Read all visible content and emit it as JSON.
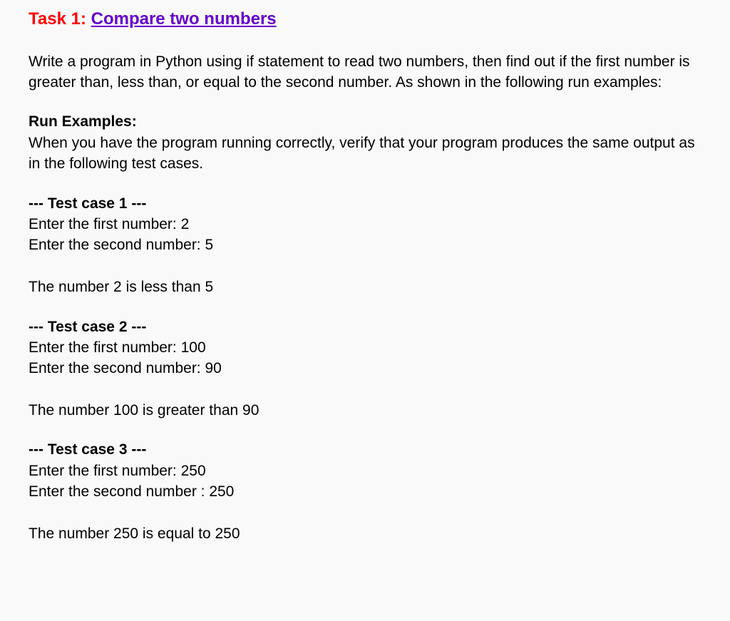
{
  "heading": {
    "label": "Task 1: ",
    "link": "Compare two numbers"
  },
  "description": "Write a program in Python using if statement to read two numbers, then find out if the first number is greater than, less than, or equal to the second number. As shown in the following run examples:",
  "run_examples": {
    "heading": "Run Examples:",
    "intro": "When you have the program running correctly, verify that your program produces the same output as in the following test cases."
  },
  "test_cases": [
    {
      "title": "--- Test case 1 ---",
      "line1": "Enter the first number: 2",
      "line2": "Enter the second number: 5",
      "result": "The number 2 is less than 5"
    },
    {
      "title": "--- Test case 2 ---",
      "line1": "Enter the first number: 100",
      "line2": "Enter the second number: 90",
      "result": "The number 100 is greater than 90"
    },
    {
      "title": "--- Test case 3 ---",
      "line1": "Enter the first number: 250",
      "line2": "Enter the second number : 250",
      "result": "The number 250 is equal to 250"
    }
  ]
}
